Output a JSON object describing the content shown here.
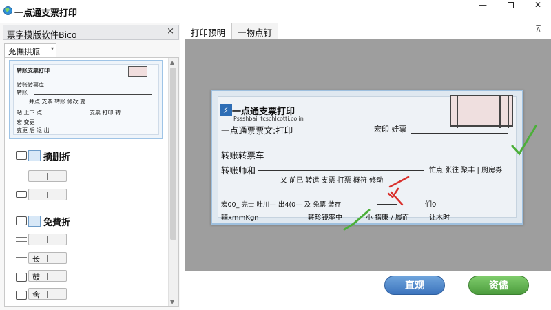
{
  "window": {
    "title": "一点通支票打印",
    "min_symbol": "—",
    "close_symbol": "✕"
  },
  "left_panel": {
    "header_label": "票字模版软件Bico",
    "close_symbol": "×",
    "subtab_label": "允撫拱瓶",
    "subtab_caret": "▾",
    "thumbnail": {
      "title": "转账支票打印",
      "line1": "转账转票库",
      "line2": "转账",
      "line3": "井点 支票 转账 修改 变",
      "line4_left": "站 上下 点",
      "line4_right": "支票 打印 转",
      "line5": "宏 变更",
      "line6": "变更 后 退 出"
    },
    "rows": [
      {
        "label": "摘删折"
      },
      {
        "label": ""
      },
      {
        "label": ""
      },
      {
        "label": "免費折"
      },
      {
        "label": ""
      },
      {
        "label": "",
        "char": "长"
      },
      {
        "label": "",
        "char": "鼓"
      },
      {
        "label": "",
        "char": "舍"
      }
    ]
  },
  "tabs": {
    "items": [
      "打印预明",
      "一物点钉"
    ],
    "pin_symbol": "⊼"
  },
  "cheque": {
    "logo_symbol": "⚡",
    "title": "一点通支票打印",
    "subtitle": "Pssshbail tcschlcotti.colin",
    "field1_label": "一点通票票文:打印",
    "field1_right": "宏印 娃票",
    "field2_label": "转账转票车",
    "field3_label": "转账师和",
    "field3_right": "忙点 张往 聚丰 | 厨房券",
    "middle_text": "乂 前已 转运 支票 打票  概符 修动",
    "row4_left": "宏00_ 完士 吐川— 出4(0— 及 免票 装存",
    "row4_right": "们0",
    "row5_left": "辅xmmKgn",
    "row5_mid": "转珍镜率中",
    "row5_mid2": "小 措康 / 履而",
    "row5_right": "让木时"
  },
  "buttons": {
    "preview": "直观",
    "confirm": "资儘"
  },
  "colors": {
    "preview_bg": "#9e9e9e",
    "cheque_border": "#9ec0df",
    "check_green": "#4caf3a",
    "cross_red": "#d9302c",
    "button_blue": "#3c74bd",
    "button_green": "#4c9c3d"
  }
}
